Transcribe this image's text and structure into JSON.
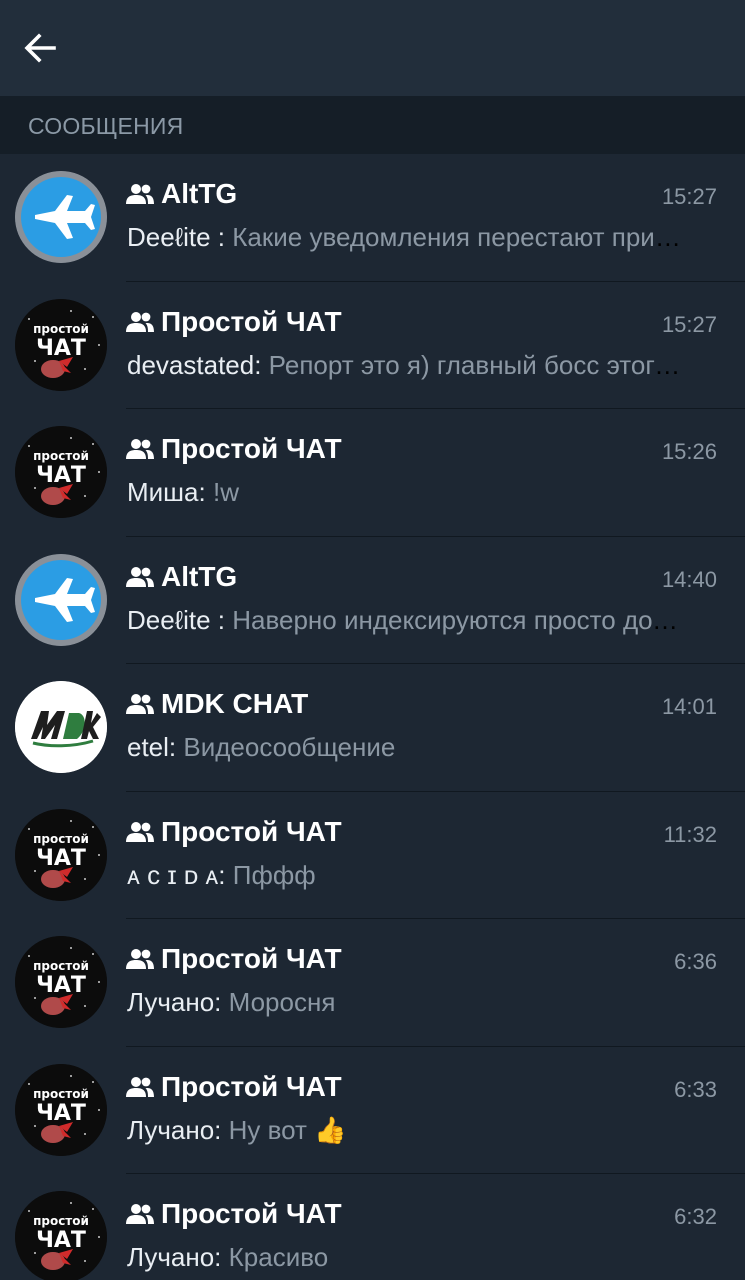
{
  "header": {
    "back_icon": "arrow-left-icon"
  },
  "section": {
    "title": "СООБЩЕНИЯ"
  },
  "colors": {
    "background": "#1d2733",
    "toolbar": "#222e3b",
    "section_header": "#151e27",
    "accent_blue": "#2b9de4"
  },
  "chats": [
    {
      "title": "AltTG",
      "time": "15:27",
      "sender": "Deeℓite :",
      "message": "Какие уведомления перестают приходить?",
      "avatar": "alttg",
      "icon": "group-icon"
    },
    {
      "title": "Простой ЧАТ",
      "time": "15:27",
      "sender": "devastated:",
      "message": "Репорт это я) главный босс этого чата",
      "avatar": "prostoy",
      "icon": "group-icon"
    },
    {
      "title": "Простой ЧАТ",
      "time": "15:26",
      "sender": "Миша:",
      "message": "!w",
      "avatar": "prostoy",
      "icon": "group-icon"
    },
    {
      "title": "AltTG",
      "time": "14:40",
      "sender": "Deeℓite :",
      "message": "Наверно индексируются просто долго",
      "avatar": "alttg",
      "icon": "group-icon"
    },
    {
      "title": "MDK CHAT",
      "time": "14:01",
      "sender": "etel:",
      "message": "Видеосообщение",
      "avatar": "mdk",
      "icon": "group-icon"
    },
    {
      "title": "Простой ЧАТ",
      "time": "11:32",
      "sender": "ᴀ ᴄ ɪ ᴅ ᴀ:",
      "message": "Пффф",
      "avatar": "prostoy",
      "icon": "group-icon"
    },
    {
      "title": "Простой ЧАТ",
      "time": "6:36",
      "sender": "Лучано:",
      "message": "Моросня",
      "avatar": "prostoy",
      "icon": "group-icon"
    },
    {
      "title": "Простой ЧАТ",
      "time": "6:33",
      "sender": "Лучано:",
      "message": "Ну вот 👍",
      "avatar": "prostoy",
      "icon": "group-icon"
    },
    {
      "title": "Простой ЧАТ",
      "time": "6:32",
      "sender": "Лучано:",
      "message": "Красиво",
      "avatar": "prostoy",
      "icon": "group-icon"
    }
  ]
}
